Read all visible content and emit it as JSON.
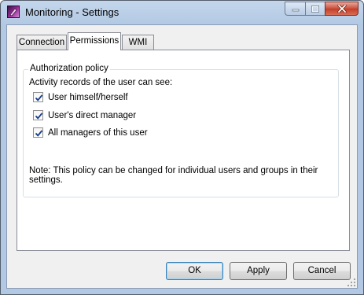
{
  "window": {
    "title": "Monitoring - Settings",
    "icon": "monitoring-app-icon",
    "caption": {
      "minimize": "minimize-icon",
      "maximize": "maximize-icon",
      "close": "close-icon"
    }
  },
  "tabs": [
    {
      "label": "Connection",
      "selected": false
    },
    {
      "label": "Permissions",
      "selected": true
    },
    {
      "label": "WMI",
      "selected": false
    }
  ],
  "authorization": {
    "group_title": "Authorization policy",
    "activity_label": "Activity records of the user can see:",
    "options": [
      {
        "label": "User himself/herself",
        "checked": true
      },
      {
        "label": "User's direct manager",
        "checked": true
      },
      {
        "label": "All managers of this user",
        "checked": true
      }
    ],
    "note": "Note: This policy can be changed for individual users and groups in their settings."
  },
  "buttons": {
    "ok": "OK",
    "apply": "Apply",
    "cancel": "Cancel"
  },
  "colors": {
    "frame": "#b3c9e3",
    "client": "#f0f0f0",
    "close_button": "#c94d39",
    "default_button_border": "#3c7fb1",
    "checkmark": "#1a3f8a"
  }
}
